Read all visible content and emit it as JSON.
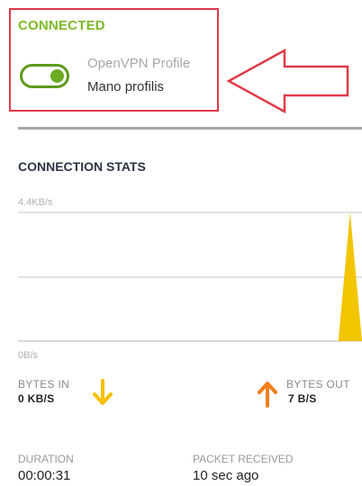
{
  "status": {
    "label": "CONNECTED",
    "toggle_on": true,
    "profile_type": "OpenVPN Profile",
    "profile_name": "Mano profilis"
  },
  "stats": {
    "title": "CONNECTION STATS",
    "chart_data": {
      "type": "area",
      "ylim_labels": [
        "4.4KB/s",
        "0B/s"
      ],
      "y_max_label": "4.4KB/s",
      "y_min_label": "0B/s",
      "series": [
        {
          "values": [
            0,
            0,
            0,
            0,
            0,
            0,
            0,
            0,
            0,
            0,
            0,
            0,
            0,
            0,
            0,
            0,
            0,
            0,
            0,
            0,
            0,
            0,
            0,
            0,
            0,
            0,
            0,
            0,
            4.4,
            0
          ]
        }
      ],
      "colors": {
        "series": "#f2c500",
        "grid": "#d9d9d9"
      }
    }
  },
  "bytes_in": {
    "title": "BYTES IN",
    "value": "0 KB/S",
    "icon": "arrow-down-icon",
    "color": "#f5c000"
  },
  "bytes_out": {
    "title": "BYTES OUT",
    "value": "7 B/S",
    "icon": "arrow-up-icon",
    "color": "#ef7f1a"
  },
  "duration": {
    "label": "DURATION",
    "value": "00:00:31"
  },
  "packet": {
    "label": "PACKET RECEIVED",
    "value": "10 sec ago"
  },
  "colors": {
    "accent_green": "#7cb826",
    "highlight_red": "#e03a47"
  }
}
